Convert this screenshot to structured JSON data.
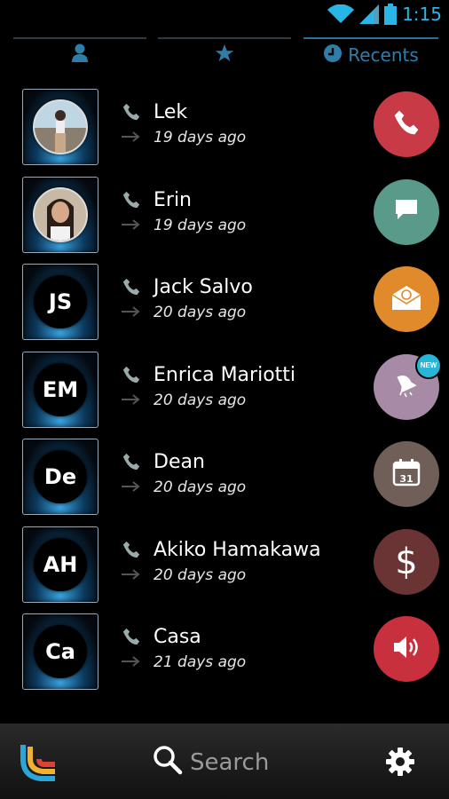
{
  "status_bar": {
    "time": "1:15",
    "icons": [
      "wifi-icon",
      "signal-icon",
      "battery-icon"
    ]
  },
  "tabs": [
    {
      "icon": "person-icon",
      "label": ""
    },
    {
      "icon": "star-icon",
      "label": ""
    },
    {
      "icon": "clock-icon",
      "label": "Recents"
    }
  ],
  "calls": [
    {
      "name": "Lek",
      "time": "19 days ago",
      "avatar": "photo",
      "action_icon": "phone-icon",
      "action_color": "#c83a46"
    },
    {
      "name": "Erin",
      "time": "19 days ago",
      "avatar": "photo",
      "action_icon": "chat-icon",
      "action_color": "#5a9a8a"
    },
    {
      "name": "Jack Salvo",
      "time": "20 days ago",
      "initials": "JS",
      "action_icon": "email-icon",
      "action_color": "#e08a2c"
    },
    {
      "name": "Enrica Mariotti",
      "time": "20 days ago",
      "initials": "EM",
      "action_icon": "notification-icon",
      "action_color": "#a68aa6",
      "badge": "NEW"
    },
    {
      "name": "Dean",
      "time": "20 days ago",
      "initials": "De",
      "action_icon": "calendar-icon",
      "action_color": "#6f5f58",
      "calendar_day": "31"
    },
    {
      "name": "Akiko Hamakawa",
      "time": "20 days ago",
      "initials": "AH",
      "action_icon": "dollar-icon",
      "action_color": "#6a3434",
      "symbol": "$"
    },
    {
      "name": "Casa",
      "time": "21 days ago",
      "initials": "Ca",
      "action_icon": "speaker-icon",
      "action_color": "#c8303e"
    }
  ],
  "bottom_bar": {
    "search_label": "Search",
    "logo_icon": "app-logo-icon",
    "settings_icon": "gear-icon"
  },
  "colors": {
    "accent": "#2f7eaa",
    "status_blue": "#29b6e6"
  }
}
